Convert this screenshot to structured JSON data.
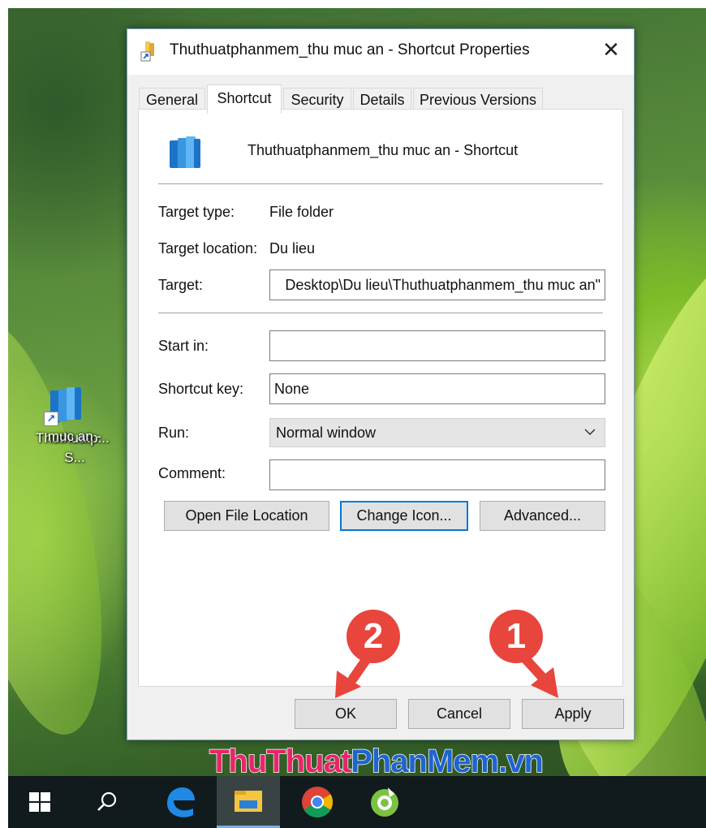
{
  "dialog": {
    "title": "Thuthuatphanmem_thu muc an - Shortcut Properties",
    "close_glyph": "✕",
    "tabs": [
      {
        "label": "General"
      },
      {
        "label": "Shortcut"
      },
      {
        "label": "Security"
      },
      {
        "label": "Details"
      },
      {
        "label": "Previous Versions"
      }
    ],
    "active_tab": "Shortcut",
    "shortcut_name": "Thuthuatphanmem_thu muc an - Shortcut",
    "target_type_label": "Target type:",
    "target_type_value": "File folder",
    "target_location_label": "Target location:",
    "target_location_value": "Du lieu",
    "target_label": "Target:",
    "target_value": "Desktop\\Du lieu\\Thuthuatphanmem_thu muc an\"",
    "start_in_label": "Start in:",
    "start_in_value": "",
    "shortcut_key_label": "Shortcut key:",
    "shortcut_key_value": "None",
    "run_label": "Run:",
    "run_value": "Normal window",
    "comment_label": "Comment:",
    "comment_value": "",
    "open_file_location_label": "Open File Location",
    "change_icon_label": "Change Icon...",
    "advanced_label": "Advanced...",
    "ok_label": "OK",
    "cancel_label": "Cancel",
    "apply_label": "Apply"
  },
  "desktop_icon": {
    "label_line1": "Thuthuatp...",
    "label_line2": "muc an - S..."
  },
  "annotations": {
    "badge_2": "2",
    "badge_1": "1",
    "color": "#e8453c"
  },
  "watermark": {
    "part1": "ThuThuat",
    "part2": "PhanMem",
    "part3": ".vn",
    "color1": "#e8256a",
    "color2": "#1e64d2"
  },
  "taskbar": {
    "items": [
      "windows-start",
      "search",
      "edge",
      "file-explorer",
      "chrome",
      "app"
    ]
  }
}
